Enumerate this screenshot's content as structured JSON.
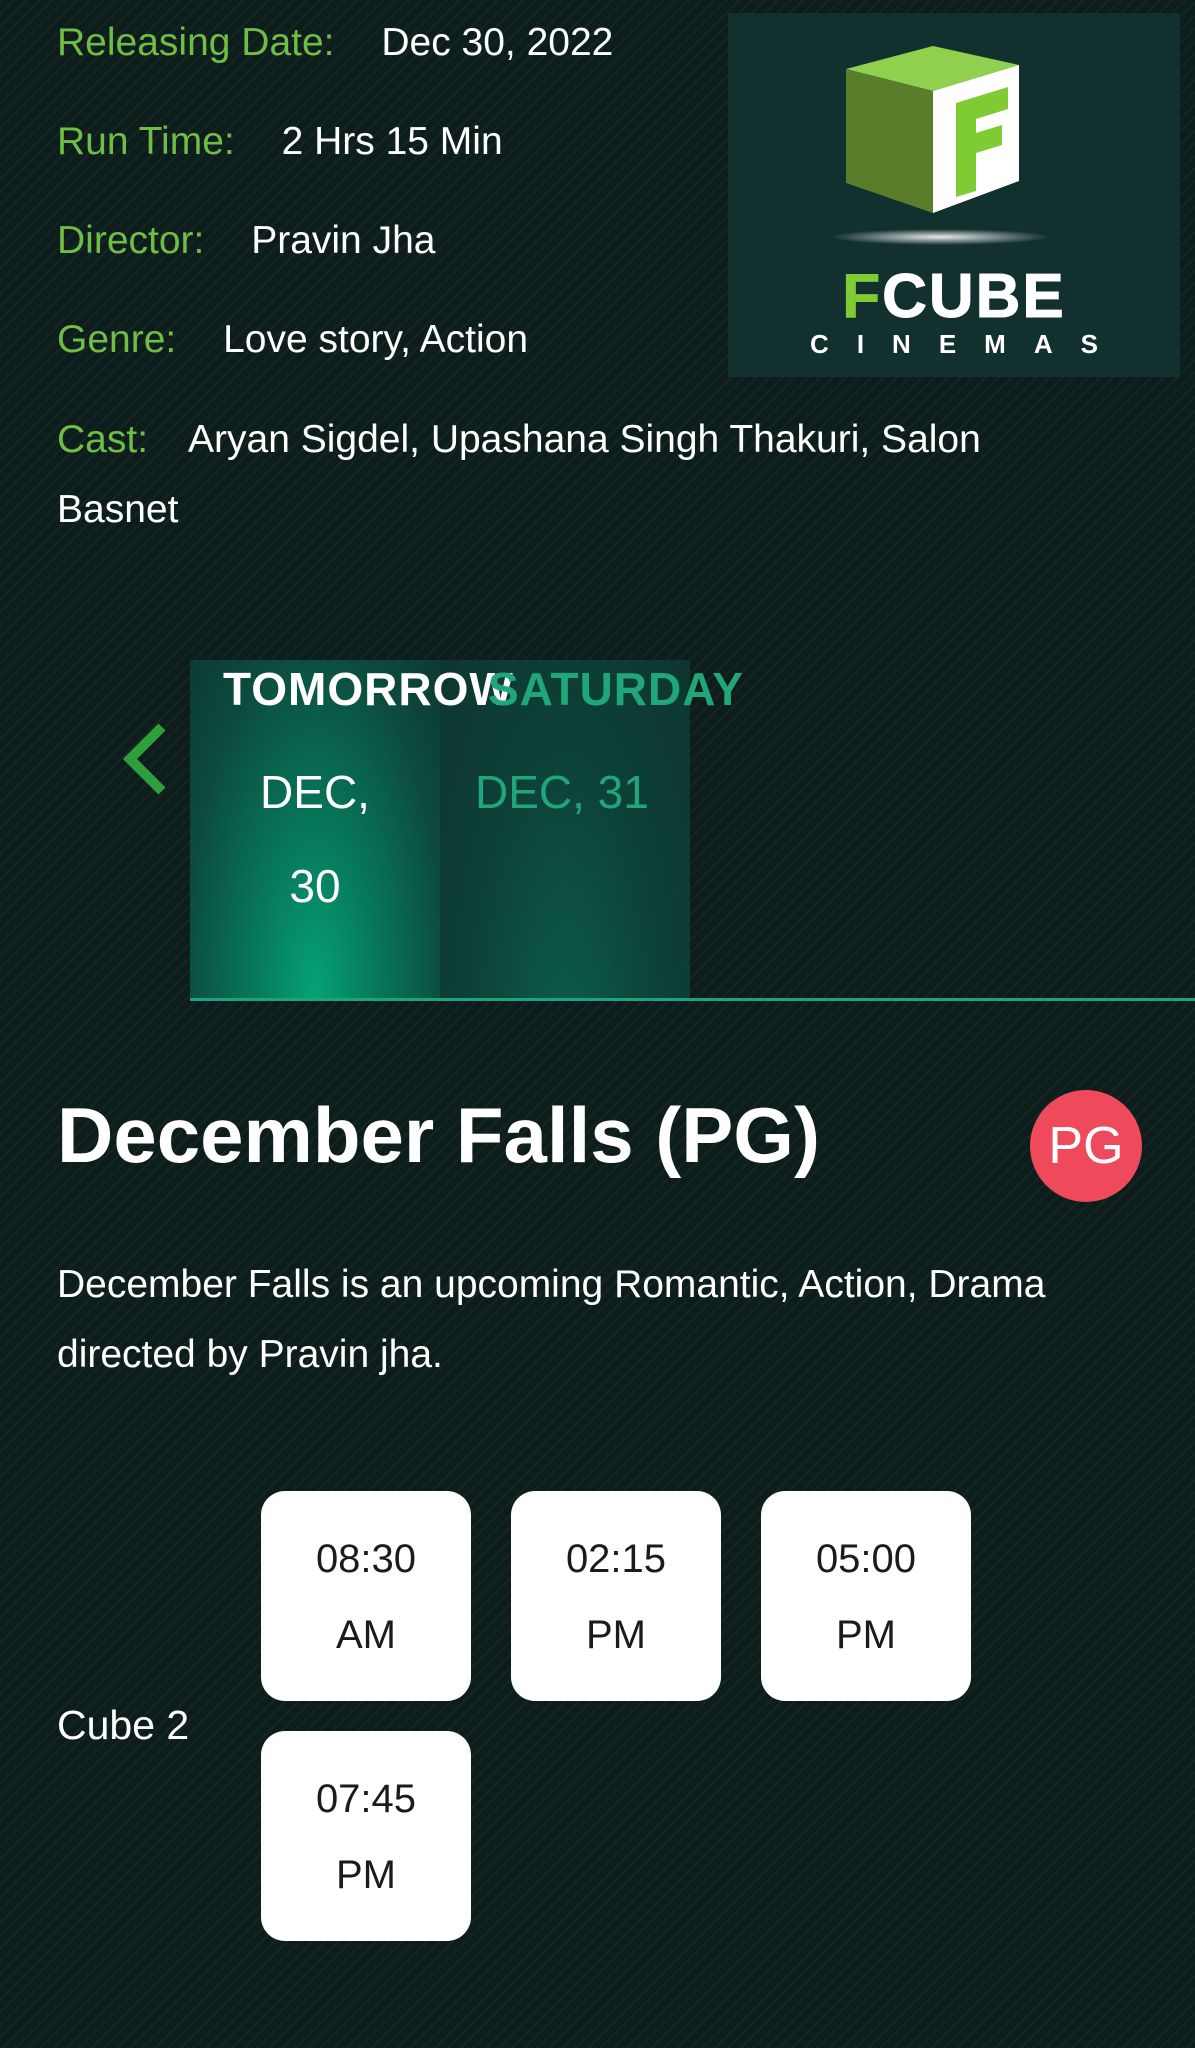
{
  "details": {
    "release": {
      "label": "Releasing Date:",
      "value": "Dec 30, 2022"
    },
    "runtime": {
      "label": "Run Time:",
      "value": "2 Hrs 15 Min"
    },
    "director": {
      "label": "Director:",
      "value": "Pravin Jha"
    },
    "genre": {
      "label": "Genre:",
      "value": "Love story, Action"
    },
    "cast": {
      "label": "Cast:",
      "value": "Aryan Sigdel, Upashana Singh Thakuri, Salon Basnet"
    }
  },
  "logo": {
    "letter": "F",
    "word": "CUBE",
    "sub": "CINEMAS"
  },
  "date_tabs": [
    {
      "day": "TOMORROW",
      "date": "DEC, 30",
      "selected": true
    },
    {
      "day": "SATURDAY",
      "date": "DEC, 31",
      "selected": false
    }
  ],
  "movie": {
    "title": "December Falls (PG)",
    "rating_badge": "PG",
    "description": "December Falls is an upcoming Romantic, Action, Drama directed by Pravin jha."
  },
  "showtimes": {
    "hall": "Cube 2",
    "slots": [
      {
        "time": "08:30",
        "period": "AM"
      },
      {
        "time": "02:15",
        "period": "PM"
      },
      {
        "time": "05:00",
        "period": "PM"
      },
      {
        "time": "07:45",
        "period": "PM"
      }
    ]
  },
  "colors": {
    "background": "#0d1d1c",
    "label_green": "#6fbd45",
    "accent_teal": "#1fa77a",
    "badge_red": "#ee4a5c"
  },
  "icons": {
    "prev": "chevron-left-icon"
  }
}
